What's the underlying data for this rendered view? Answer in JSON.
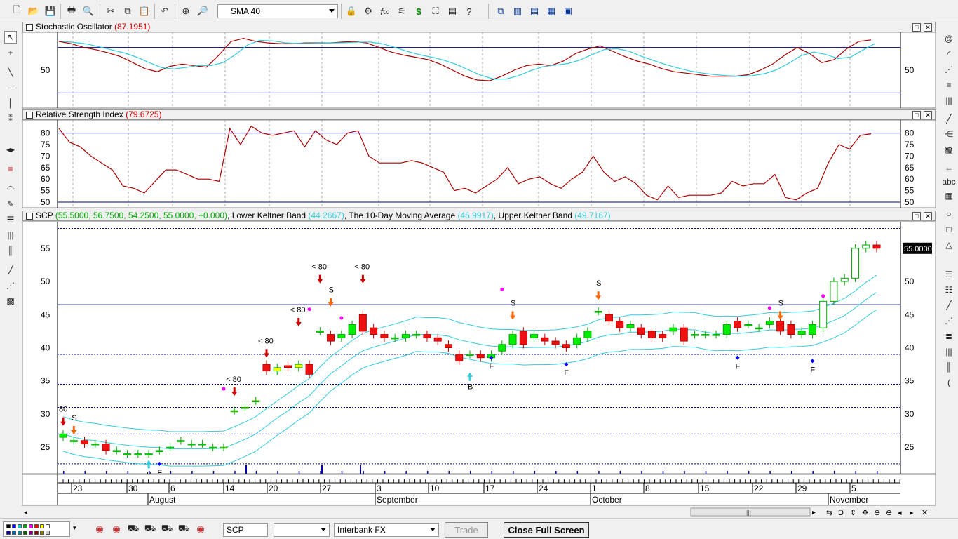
{
  "toolbar": {
    "indicator_select": "SMA 40"
  },
  "panels": {
    "stoch": {
      "name": "Stochastic Oscillator",
      "value": "(87.1951)",
      "axis_labels": [
        "50"
      ]
    },
    "rsi": {
      "name": "Relative Strength Index",
      "value": "(79.6725)",
      "axis_labels": [
        "80",
        "75",
        "70",
        "65",
        "60",
        "55",
        "50"
      ]
    },
    "price": {
      "symbol": "SCP",
      "ohlc": "(55.5000, 56.7500, 54.2500, 55.0000, +0.000)",
      "lower_band_label": "Lower Keltner Band",
      "lower_band_value": "(44.2667)",
      "ma_label": "The 10-Day Moving Average",
      "ma_value": "(46.9917)",
      "upper_band_label": "Upper Keltner Band",
      "upper_band_value": "(49.7167)",
      "last_price": "55.0000",
      "axis_labels": [
        "55",
        "50",
        "45",
        "40",
        "35",
        "30",
        "25"
      ]
    }
  },
  "colors": {
    "up": "#00ee00",
    "down": "#ee1111",
    "neutral_up": "#ffff00",
    "band": "#33ccdd",
    "stoch_k": "#aa0000",
    "stoch_d": "#33ccdd",
    "hline": "#000080"
  },
  "signals": [
    "80",
    "S",
    "B",
    "F",
    "< 80",
    "< 80",
    "< 80",
    "< 80",
    "S",
    "< 80",
    "S",
    "F",
    "F",
    "B",
    "S",
    "F",
    "S",
    "F",
    "F"
  ],
  "xaxis": {
    "day_labels": [
      "23",
      "30",
      "6",
      "14",
      "20",
      "27",
      "3",
      "10",
      "17",
      "24",
      "1",
      "8",
      "15",
      "22",
      "29",
      "5"
    ],
    "month_labels": [
      "August",
      "September",
      "October",
      "November"
    ]
  },
  "bottom": {
    "symbol_input": "SCP",
    "feed_select": "Interbank FX",
    "trade_button": "Trade",
    "close_fullscreen": "Close Full Screen"
  },
  "chart_data": {
    "type": "candlestick",
    "series": [
      {
        "name": "Stochastic Oscillator",
        "k": [
          88,
          85,
          80,
          77,
          73,
          68,
          60,
          52,
          48,
          55,
          58,
          56,
          54,
          70,
          88,
          92,
          88,
          86,
          85,
          85,
          86,
          86,
          86,
          87,
          88,
          86,
          80,
          74,
          70,
          67,
          64,
          58,
          50,
          42,
          37,
          36,
          42,
          50,
          56,
          58,
          56,
          62,
          72,
          78,
          82,
          75,
          68,
          62,
          58,
          52,
          48,
          46,
          44,
          42,
          42,
          42,
          44,
          50,
          58,
          70,
          80,
          72,
          60,
          64,
          78,
          88,
          90
        ]
      },
      {
        "name": "Relative Strength Index",
        "values": [
          82,
          76,
          74,
          70,
          67,
          64,
          57,
          56,
          54,
          59,
          64,
          64,
          62,
          60,
          60,
          59,
          82,
          75,
          83,
          80,
          79,
          80,
          81,
          74,
          81,
          77,
          75,
          80,
          81,
          70,
          67,
          67,
          67,
          68,
          67,
          65,
          63,
          55,
          56,
          54,
          57,
          60,
          65,
          58,
          60,
          61,
          58,
          56,
          60,
          63,
          70,
          63,
          59,
          61,
          58,
          53,
          51,
          57,
          52,
          53,
          53,
          53,
          54,
          59,
          57,
          58,
          58,
          62,
          52,
          51,
          54,
          56,
          67,
          75,
          73,
          79,
          79.67
        ]
      },
      {
        "name": "SCP",
        "open": [
          26.5,
          26,
          26,
          25.5,
          25.5,
          24.5,
          24,
          24,
          24,
          24.5,
          25,
          26,
          25.5,
          25.5,
          25,
          25,
          30.5,
          31,
          32,
          37.5,
          36.5,
          37.3,
          37,
          37.5,
          42.5,
          42,
          41.5,
          42,
          45,
          43,
          42,
          41.5,
          41.5,
          42,
          42,
          41.5,
          40.5,
          39,
          39,
          39,
          38.5,
          39.5,
          40.5,
          42.5,
          41.5,
          41.5,
          41,
          40.5,
          40.5,
          41.5,
          45.5,
          45,
          44,
          43,
          43,
          42.5,
          42,
          42.5,
          43,
          42,
          42,
          42,
          42,
          44,
          43.5,
          43,
          43.5,
          44,
          43.5,
          42,
          42,
          43,
          47,
          50,
          50.5,
          55,
          55.5
        ],
        "close": [
          27,
          26,
          25.5,
          25.5,
          24.5,
          24.5,
          24,
          24,
          24,
          24.5,
          25,
          26,
          25.5,
          25.5,
          25,
          25,
          30.5,
          31,
          32,
          36.5,
          37,
          37,
          37.5,
          36,
          42.5,
          41,
          42,
          43.5,
          42.5,
          42,
          41.5,
          41.5,
          42,
          42,
          41.5,
          41,
          40,
          38,
          39,
          38.5,
          39,
          40.5,
          42,
          40.5,
          42,
          41,
          40.5,
          40,
          41.5,
          42.5,
          45.5,
          44,
          43,
          43.5,
          42,
          41.5,
          41.5,
          43,
          41,
          42,
          42,
          42,
          43.5,
          43,
          43.5,
          43,
          44,
          42.5,
          42,
          42.5,
          43.5,
          47,
          50,
          50.5,
          55,
          55.5,
          55
        ]
      }
    ],
    "x_labels": [
      "23",
      "30",
      "6",
      "14",
      "20",
      "27",
      "3",
      "10",
      "17",
      "24",
      "1",
      "8",
      "15",
      "22",
      "29",
      "5"
    ],
    "months": [
      "August",
      "September",
      "October",
      "November"
    ],
    "y_range": [
      21,
      59
    ],
    "rsi_range": [
      50,
      82
    ],
    "stoch_levels": [
      80,
      20
    ],
    "rsi_level": 80,
    "price_hline": 46.5
  }
}
